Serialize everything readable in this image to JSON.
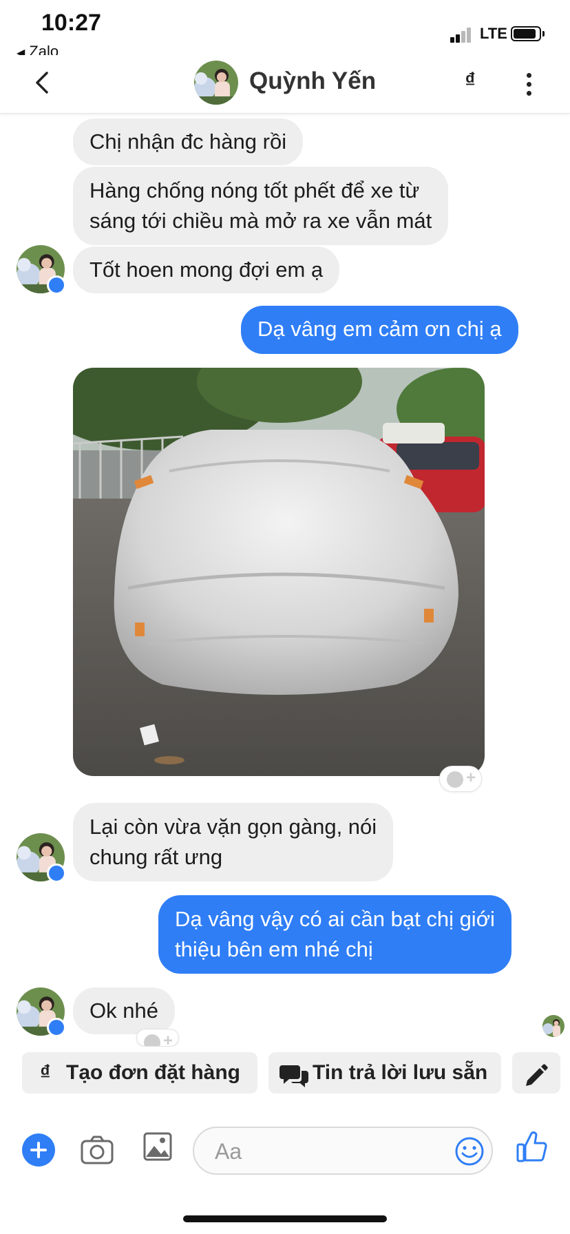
{
  "status_bar": {
    "time": "10:27",
    "back_app": "Zalo",
    "network": "LTE"
  },
  "header": {
    "contact_name": "Quỳnh Yến",
    "currency_symbol": "₫"
  },
  "messages": [
    {
      "side": "in",
      "text": "Chị nhận đc hàng rồi"
    },
    {
      "side": "in",
      "lines": [
        "Hàng chống nóng tốt phết để xe từ",
        "sáng tới chiều mà mở ra xe vẫn mát"
      ]
    },
    {
      "side": "in",
      "text": "Tốt hoen mong đợi em ạ"
    },
    {
      "side": "out",
      "text": "Dạ vâng em cảm ơn chị ạ"
    },
    {
      "side": "in",
      "type": "photo"
    },
    {
      "side": "in",
      "lines": [
        "Lại còn vừa vặn gọn gàng, nói",
        "chung rất ưng"
      ]
    },
    {
      "side": "out",
      "lines": [
        "Dạ vâng vậy có ai cần bạt chị giới",
        "thiệu bên em nhé chị"
      ]
    },
    {
      "side": "in",
      "text": "Ok nhé"
    }
  ],
  "quick_actions": {
    "create_order": {
      "icon": "₫",
      "label": "Tạo đơn đặt hàng"
    },
    "saved_replies": {
      "label": "Tin trả lời lưu sẵn"
    }
  },
  "composer": {
    "placeholder": "Aa"
  },
  "colors": {
    "accent": "#2f7ef6",
    "incoming_bubble": "#eeeeee",
    "outgoing_bubble": "#2f7ef6"
  }
}
